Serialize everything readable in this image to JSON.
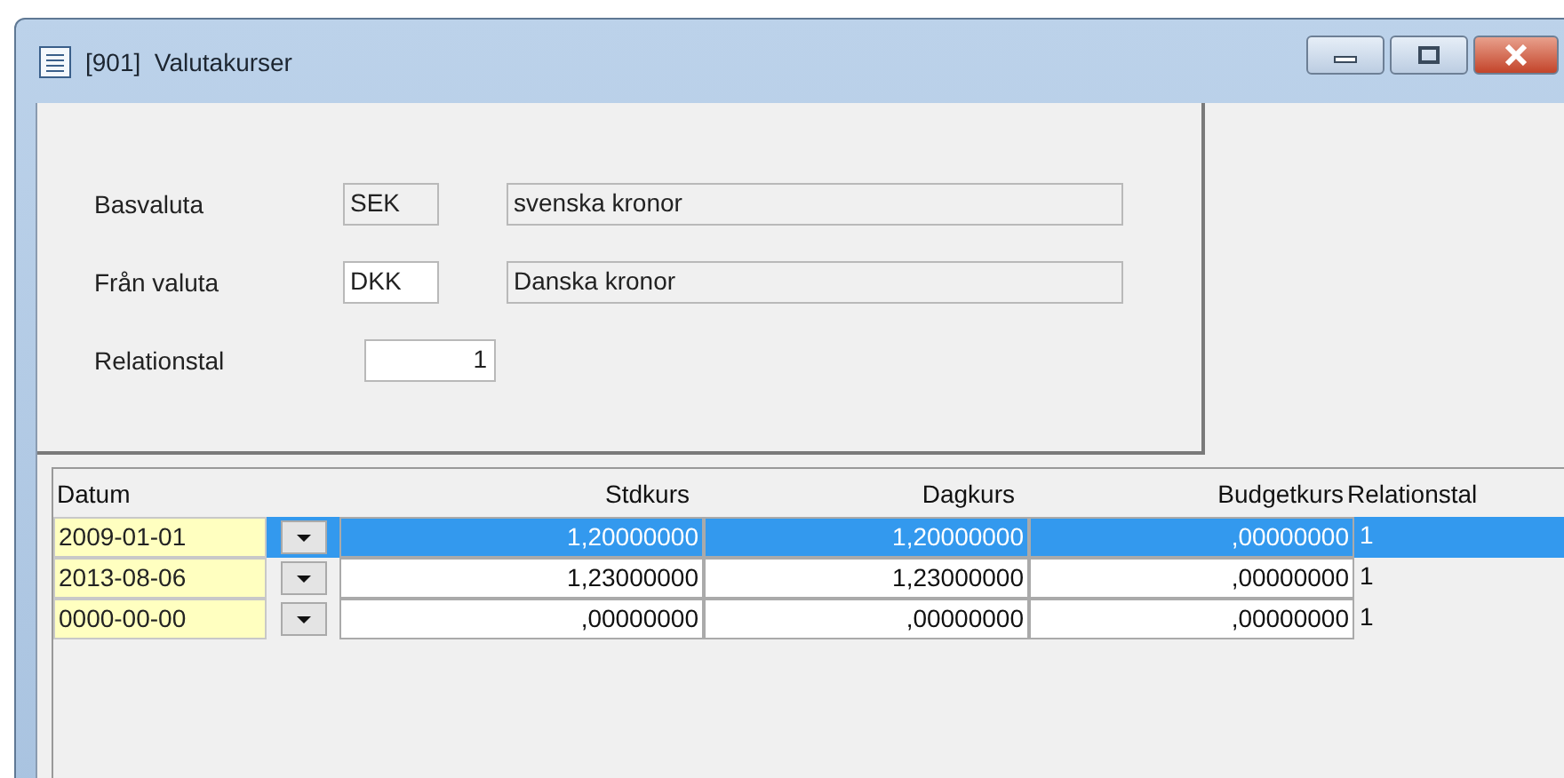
{
  "window": {
    "title": "[901]  Valutakurser"
  },
  "form": {
    "fields": [
      {
        "label": "Basvaluta",
        "code": "SEK",
        "description": "svenska kronor",
        "editable": false
      },
      {
        "label": "Från valuta",
        "code": "DKK",
        "description": "Danska kronor",
        "editable": true
      }
    ],
    "ratio": {
      "label": "Relationstal",
      "value": "1"
    }
  },
  "table": {
    "columns": [
      "Datum",
      "Stdkurs",
      "Dagkurs",
      "Budgetkurs",
      "Relationstal"
    ],
    "rows": [
      {
        "selected": true,
        "cells": [
          "2009-01-01",
          "1,20000000",
          "1,20000000",
          ",00000000",
          "1"
        ]
      },
      {
        "selected": false,
        "cells": [
          "2013-08-06",
          "1,23000000",
          "1,23000000",
          ",00000000",
          "1"
        ]
      },
      {
        "selected": false,
        "cells": [
          "0000-00-00",
          ",00000000",
          ",00000000",
          ",00000000",
          "1"
        ]
      }
    ]
  }
}
